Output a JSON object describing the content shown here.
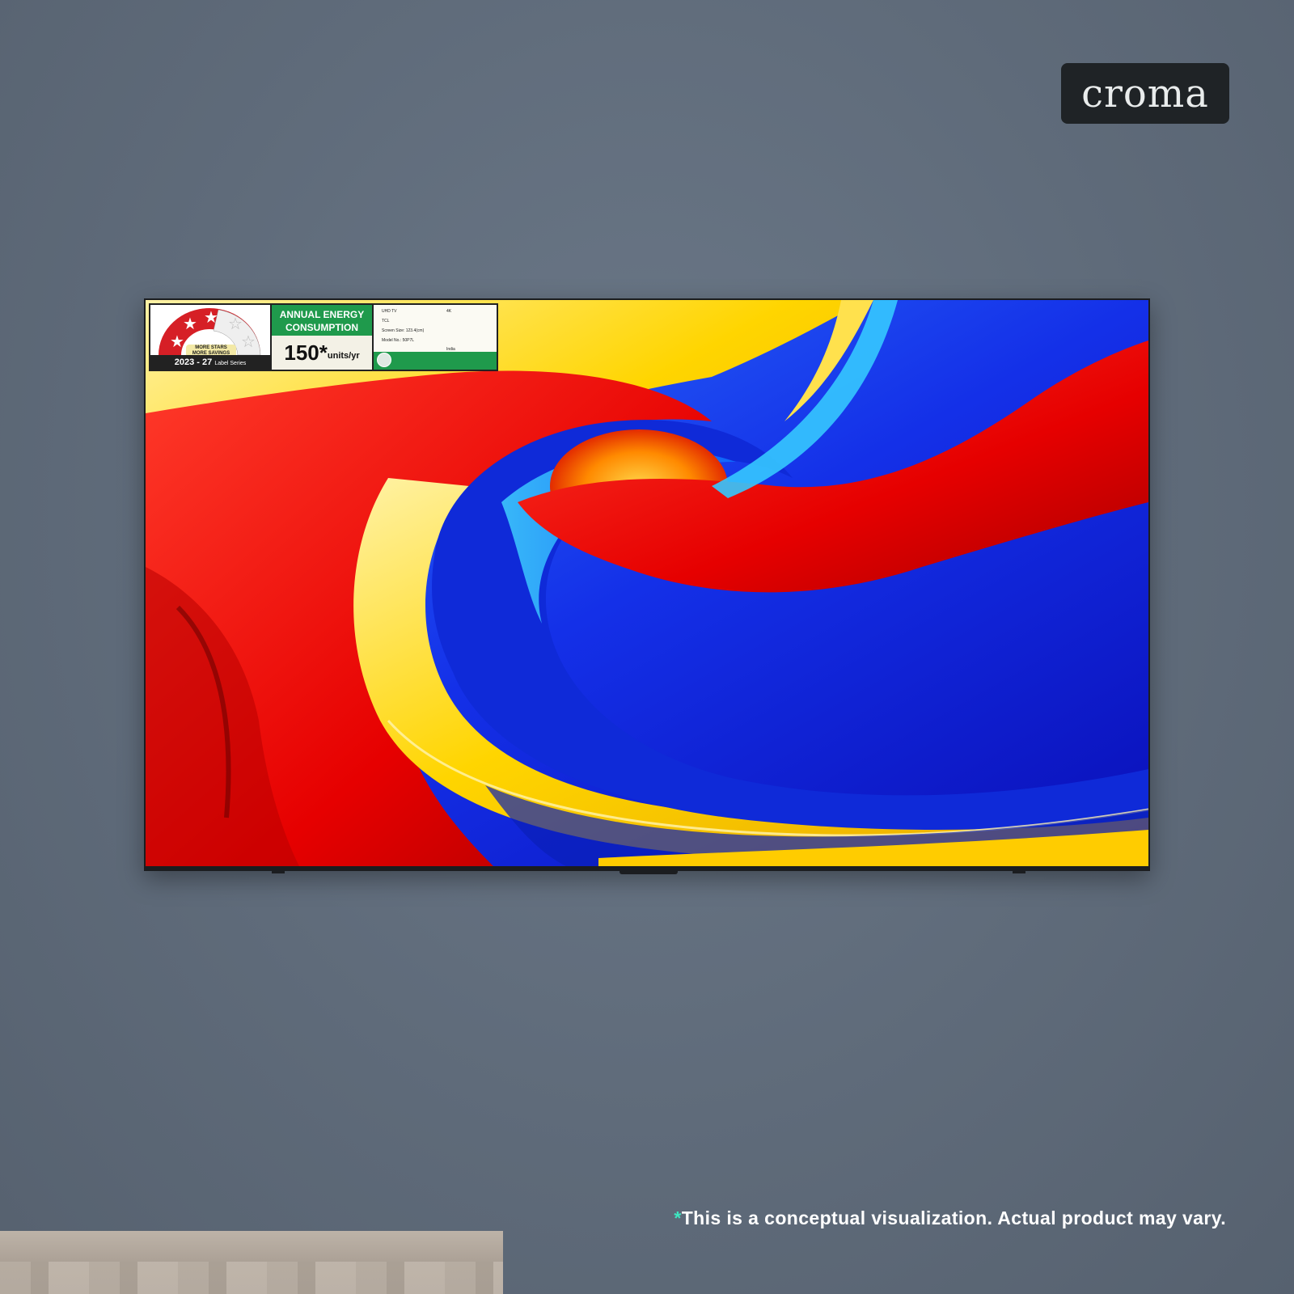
{
  "brand": {
    "logo_text": "croma"
  },
  "energy_label": {
    "savings_line1": "MORE STARS",
    "savings_line2": "MORE SAVINGS",
    "series_year": "2023 - 27",
    "series_suffix": "Label Series",
    "consumption_title": "ANNUAL ENERGY CONSUMPTION",
    "consumption_value": "150*",
    "consumption_unit": "units/yr",
    "product_type": "UHD TV",
    "resolution": "4K",
    "brand_name": "TCL",
    "screen_size": "Screen Size: 123.4(cm)",
    "model_no": "Model No.: 50P7L",
    "country": "India"
  },
  "disclaimer": {
    "asterisk": "*",
    "text": "This is a conceptual visualization. Actual product may vary."
  },
  "colors": {
    "wall": "#5f6b7a",
    "logo_bg": "#1f2326",
    "accent_teal": "#3ee6c1",
    "label_green": "#1f9a4c"
  }
}
